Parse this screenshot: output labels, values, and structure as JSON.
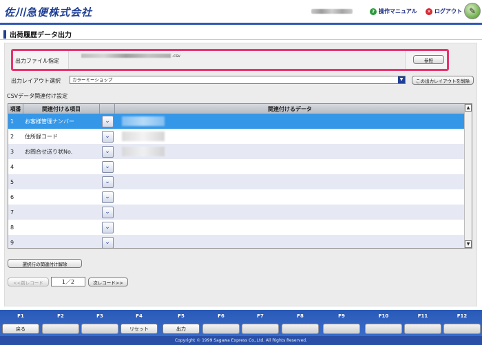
{
  "header": {
    "logo": "佐川急便株式会社",
    "manual_label": "操作マニュアル",
    "logout_label": "ログアウト"
  },
  "page": {
    "title": "出荷履歴データ出力"
  },
  "file_select": {
    "label": "出力ファイル指定",
    "extension": ".csv",
    "browse_label": "参照"
  },
  "layout_select": {
    "label": "出力レイアウト選択",
    "selected": "カラーミーショップ",
    "delete_label": "この出力レイアウトを削除"
  },
  "csv_mapping": {
    "section_label": "CSVデータ関連付け設定",
    "columns": [
      "項番",
      "関連付ける項目",
      "",
      "関連付けるデータ"
    ],
    "rows": [
      {
        "no": "1",
        "item": "お客様管理ナンバー"
      },
      {
        "no": "2",
        "item": "住所録コード"
      },
      {
        "no": "3",
        "item": "お問合せ送り状No."
      },
      {
        "no": "4",
        "item": ""
      },
      {
        "no": "5",
        "item": ""
      },
      {
        "no": "6",
        "item": ""
      },
      {
        "no": "7",
        "item": ""
      },
      {
        "no": "8",
        "item": ""
      },
      {
        "no": "9",
        "item": ""
      }
    ],
    "clear_label": "選択行の関連付け解除"
  },
  "pager": {
    "prev_label": "<<前レコード",
    "page": "1／2",
    "next_label": "次レコード>>"
  },
  "fkeys": [
    {
      "key": "F1",
      "label": "戻る"
    },
    {
      "key": "F2",
      "label": ""
    },
    {
      "key": "F3",
      "label": ""
    },
    {
      "key": "F4",
      "label": "リセット"
    },
    {
      "key": "F5",
      "label": "出力"
    },
    {
      "key": "F6",
      "label": ""
    },
    {
      "key": "F7",
      "label": ""
    },
    {
      "key": "F8",
      "label": ""
    },
    {
      "key": "F9",
      "label": ""
    },
    {
      "key": "F10",
      "label": ""
    },
    {
      "key": "F11",
      "label": ""
    },
    {
      "key": "F12",
      "label": ""
    }
  ],
  "footer": {
    "copyright": "Copyright © 1999 Sagawa Express Co.,Ltd. All Rights Reserved."
  },
  "colors": {
    "brand_blue": "#1f3f95",
    "highlight_border": "#e8336f",
    "selected_row": "#3597e8"
  }
}
